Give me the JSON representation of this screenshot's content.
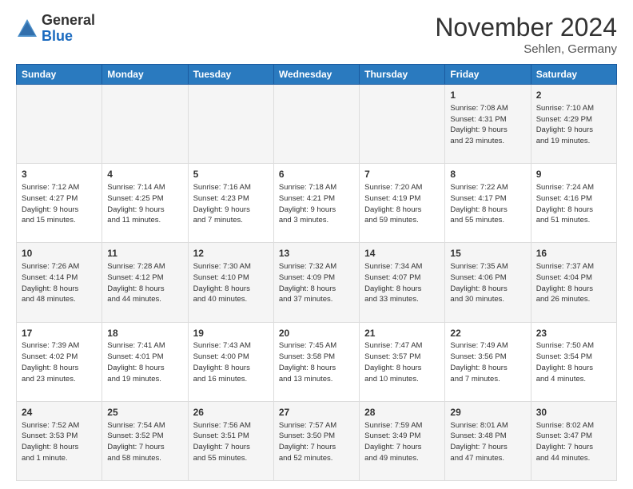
{
  "logo": {
    "general": "General",
    "blue": "Blue"
  },
  "header": {
    "month": "November 2024",
    "location": "Sehlen, Germany"
  },
  "weekdays": [
    "Sunday",
    "Monday",
    "Tuesday",
    "Wednesday",
    "Thursday",
    "Friday",
    "Saturday"
  ],
  "weeks": [
    [
      {
        "day": "",
        "info": ""
      },
      {
        "day": "",
        "info": ""
      },
      {
        "day": "",
        "info": ""
      },
      {
        "day": "",
        "info": ""
      },
      {
        "day": "",
        "info": ""
      },
      {
        "day": "1",
        "info": "Sunrise: 7:08 AM\nSunset: 4:31 PM\nDaylight: 9 hours\nand 23 minutes."
      },
      {
        "day": "2",
        "info": "Sunrise: 7:10 AM\nSunset: 4:29 PM\nDaylight: 9 hours\nand 19 minutes."
      }
    ],
    [
      {
        "day": "3",
        "info": "Sunrise: 7:12 AM\nSunset: 4:27 PM\nDaylight: 9 hours\nand 15 minutes."
      },
      {
        "day": "4",
        "info": "Sunrise: 7:14 AM\nSunset: 4:25 PM\nDaylight: 9 hours\nand 11 minutes."
      },
      {
        "day": "5",
        "info": "Sunrise: 7:16 AM\nSunset: 4:23 PM\nDaylight: 9 hours\nand 7 minutes."
      },
      {
        "day": "6",
        "info": "Sunrise: 7:18 AM\nSunset: 4:21 PM\nDaylight: 9 hours\nand 3 minutes."
      },
      {
        "day": "7",
        "info": "Sunrise: 7:20 AM\nSunset: 4:19 PM\nDaylight: 8 hours\nand 59 minutes."
      },
      {
        "day": "8",
        "info": "Sunrise: 7:22 AM\nSunset: 4:17 PM\nDaylight: 8 hours\nand 55 minutes."
      },
      {
        "day": "9",
        "info": "Sunrise: 7:24 AM\nSunset: 4:16 PM\nDaylight: 8 hours\nand 51 minutes."
      }
    ],
    [
      {
        "day": "10",
        "info": "Sunrise: 7:26 AM\nSunset: 4:14 PM\nDaylight: 8 hours\nand 48 minutes."
      },
      {
        "day": "11",
        "info": "Sunrise: 7:28 AM\nSunset: 4:12 PM\nDaylight: 8 hours\nand 44 minutes."
      },
      {
        "day": "12",
        "info": "Sunrise: 7:30 AM\nSunset: 4:10 PM\nDaylight: 8 hours\nand 40 minutes."
      },
      {
        "day": "13",
        "info": "Sunrise: 7:32 AM\nSunset: 4:09 PM\nDaylight: 8 hours\nand 37 minutes."
      },
      {
        "day": "14",
        "info": "Sunrise: 7:34 AM\nSunset: 4:07 PM\nDaylight: 8 hours\nand 33 minutes."
      },
      {
        "day": "15",
        "info": "Sunrise: 7:35 AM\nSunset: 4:06 PM\nDaylight: 8 hours\nand 30 minutes."
      },
      {
        "day": "16",
        "info": "Sunrise: 7:37 AM\nSunset: 4:04 PM\nDaylight: 8 hours\nand 26 minutes."
      }
    ],
    [
      {
        "day": "17",
        "info": "Sunrise: 7:39 AM\nSunset: 4:02 PM\nDaylight: 8 hours\nand 23 minutes."
      },
      {
        "day": "18",
        "info": "Sunrise: 7:41 AM\nSunset: 4:01 PM\nDaylight: 8 hours\nand 19 minutes."
      },
      {
        "day": "19",
        "info": "Sunrise: 7:43 AM\nSunset: 4:00 PM\nDaylight: 8 hours\nand 16 minutes."
      },
      {
        "day": "20",
        "info": "Sunrise: 7:45 AM\nSunset: 3:58 PM\nDaylight: 8 hours\nand 13 minutes."
      },
      {
        "day": "21",
        "info": "Sunrise: 7:47 AM\nSunset: 3:57 PM\nDaylight: 8 hours\nand 10 minutes."
      },
      {
        "day": "22",
        "info": "Sunrise: 7:49 AM\nSunset: 3:56 PM\nDaylight: 8 hours\nand 7 minutes."
      },
      {
        "day": "23",
        "info": "Sunrise: 7:50 AM\nSunset: 3:54 PM\nDaylight: 8 hours\nand 4 minutes."
      }
    ],
    [
      {
        "day": "24",
        "info": "Sunrise: 7:52 AM\nSunset: 3:53 PM\nDaylight: 8 hours\nand 1 minute."
      },
      {
        "day": "25",
        "info": "Sunrise: 7:54 AM\nSunset: 3:52 PM\nDaylight: 7 hours\nand 58 minutes."
      },
      {
        "day": "26",
        "info": "Sunrise: 7:56 AM\nSunset: 3:51 PM\nDaylight: 7 hours\nand 55 minutes."
      },
      {
        "day": "27",
        "info": "Sunrise: 7:57 AM\nSunset: 3:50 PM\nDaylight: 7 hours\nand 52 minutes."
      },
      {
        "day": "28",
        "info": "Sunrise: 7:59 AM\nSunset: 3:49 PM\nDaylight: 7 hours\nand 49 minutes."
      },
      {
        "day": "29",
        "info": "Sunrise: 8:01 AM\nSunset: 3:48 PM\nDaylight: 7 hours\nand 47 minutes."
      },
      {
        "day": "30",
        "info": "Sunrise: 8:02 AM\nSunset: 3:47 PM\nDaylight: 7 hours\nand 44 minutes."
      }
    ]
  ]
}
